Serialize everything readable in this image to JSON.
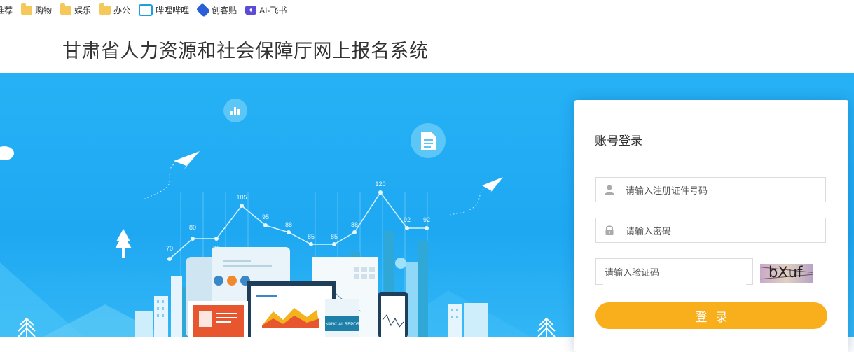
{
  "bookmarks": [
    {
      "label": "推荐",
      "icon": "none"
    },
    {
      "label": "购物",
      "icon": "folder-icon"
    },
    {
      "label": "娱乐",
      "icon": "folder-icon"
    },
    {
      "label": "办公",
      "icon": "folder-icon"
    },
    {
      "label": "哔哩哔哩",
      "icon": "bilibili-icon"
    },
    {
      "label": "创客贴",
      "icon": "chuangketie-icon"
    },
    {
      "label": "AI-飞书",
      "icon": "ai-feishu-icon"
    }
  ],
  "header": {
    "title": "甘肃省人力资源和社会保障厅网上报名系统"
  },
  "banner": {
    "chart_points": [
      "70",
      "80",
      "80",
      "105",
      "95",
      "88",
      "85",
      "85",
      "88",
      "120",
      "92",
      "92"
    ],
    "report_label": "FINANCIAL REPORT"
  },
  "login": {
    "title": "账号登录",
    "username_placeholder": "请输入注册证件号码",
    "password_placeholder": "请输入密码",
    "captcha_placeholder": "请输入验证码",
    "captcha_text": "bXuf",
    "submit_label": "登录"
  },
  "colors": {
    "banner": "#23aef4",
    "button": "#f9af1c",
    "card": "#ffffff"
  }
}
